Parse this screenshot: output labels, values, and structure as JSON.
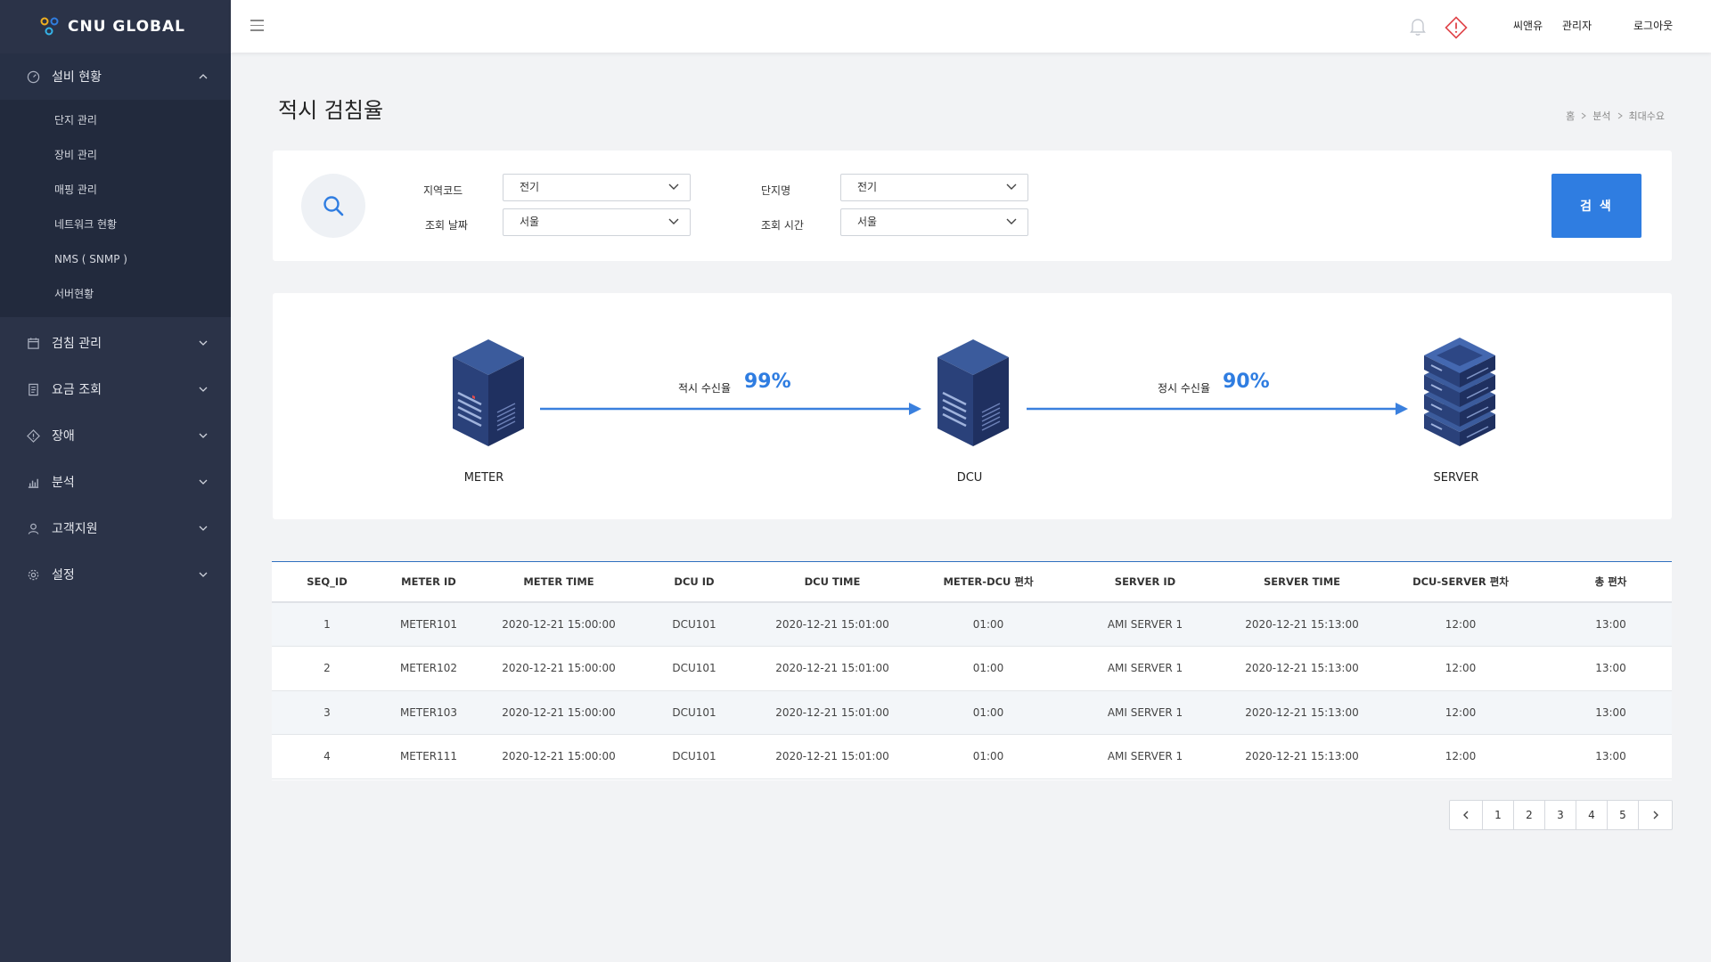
{
  "brand": {
    "logo_text": "CNU GLOBAL"
  },
  "sidebar": {
    "sections": [
      {
        "label": "설비 현황",
        "icon": "gauge-icon",
        "open": true,
        "items": [
          "단지 관리",
          "장비 관리",
          "매핑 관리",
          "네트워크 현황",
          "NMS ( SNMP )",
          "서버현황"
        ]
      },
      {
        "label": "검침 관리",
        "icon": "calendar-icon",
        "open": false
      },
      {
        "label": "요금 조회",
        "icon": "document-icon",
        "open": false
      },
      {
        "label": "장애",
        "icon": "diamond-alert-icon",
        "open": false
      },
      {
        "label": "분석",
        "icon": "bar-chart-icon",
        "open": false
      },
      {
        "label": "고객지원",
        "icon": "user-icon",
        "open": false
      },
      {
        "label": "설정",
        "icon": "gear-icon",
        "open": false
      }
    ]
  },
  "header": {
    "company": "씨앤유",
    "role": "관리자",
    "logout": "로그아웃"
  },
  "page": {
    "title": "적시 검침율",
    "breadcrumb": [
      "홈",
      "분석",
      "최대수요"
    ]
  },
  "search": {
    "region_label": "지역코드",
    "region_value": "전기",
    "complex_label": "단지명",
    "complex_value": "전기",
    "date_label": "조회 날짜",
    "date_value": "서울",
    "time_label": "조회 시간",
    "time_value": "서울",
    "button": "검 색"
  },
  "flow": {
    "meter_label": "METER",
    "dcu_label": "DCU",
    "server_label": "SERVER",
    "rate1_label": "적시 수신율",
    "rate1_value": "99%",
    "rate2_label": "정시 수신율",
    "rate2_value": "90%"
  },
  "table": {
    "headers": [
      "SEQ_ID",
      "METER ID",
      "METER TIME",
      "DCU ID",
      "DCU TIME",
      "METER-DCU 편차",
      "SERVER ID",
      "SERVER TIME",
      "DCU-SERVER 편차",
      "총 편차"
    ],
    "rows": [
      [
        "1",
        "METER101",
        "2020-12-21 15:00:00",
        "DCU101",
        "2020-12-21 15:01:00",
        "01:00",
        "AMI SERVER 1",
        "2020-12-21 15:13:00",
        "12:00",
        "13:00"
      ],
      [
        "2",
        "METER102",
        "2020-12-21 15:00:00",
        "DCU101",
        "2020-12-21 15:01:00",
        "01:00",
        "AMI SERVER 1",
        "2020-12-21 15:13:00",
        "12:00",
        "13:00"
      ],
      [
        "3",
        "METER103",
        "2020-12-21 15:00:00",
        "DCU101",
        "2020-12-21 15:01:00",
        "01:00",
        "AMI SERVER 1",
        "2020-12-21 15:13:00",
        "12:00",
        "13:00"
      ],
      [
        "4",
        "METER111",
        "2020-12-21 15:00:00",
        "DCU101",
        "2020-12-21 15:01:00",
        "01:00",
        "AMI SERVER 1",
        "2020-12-21 15:13:00",
        "12:00",
        "13:00"
      ]
    ]
  },
  "pagination": {
    "pages": [
      "1",
      "2",
      "3",
      "4",
      "5"
    ]
  },
  "colors": {
    "sidebar_bg": "#2b3348",
    "accent": "#2f7de1",
    "alert": "#e0454a"
  }
}
